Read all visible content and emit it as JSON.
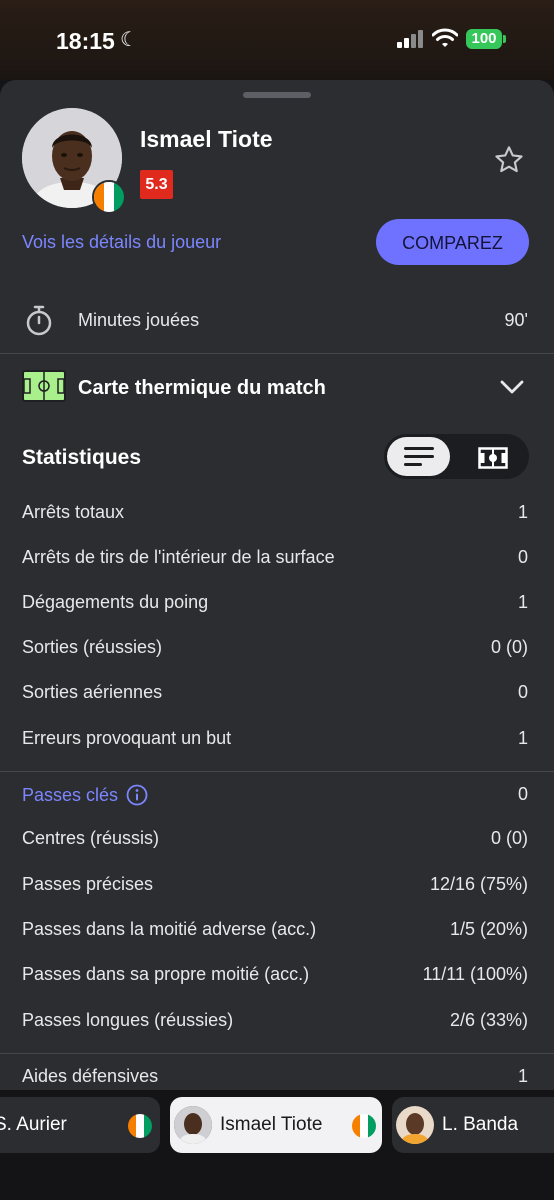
{
  "status_bar": {
    "time": "18:15",
    "battery": "100"
  },
  "player": {
    "name": "Ismael Tiote",
    "rating": "5.3",
    "details_link": "Vois les détails du joueur",
    "compare_label": "COMPAREZ"
  },
  "minutes": {
    "label": "Minutes jouées",
    "value": "90'"
  },
  "heatmap": {
    "label": "Carte thermique du match"
  },
  "stats": {
    "title": "Statistiques",
    "group1": [
      {
        "label": "Arrêts totaux",
        "value": "1"
      },
      {
        "label": "Arrêts de tirs de l'intérieur de la surface",
        "value": "0"
      },
      {
        "label": "Dégagements du poing",
        "value": "1"
      },
      {
        "label": "Sorties (réussies)",
        "value": "0 (0)"
      },
      {
        "label": "Sorties aériennes",
        "value": "0"
      },
      {
        "label": "Erreurs provoquant un but",
        "value": "1"
      }
    ],
    "group2": [
      {
        "label": "Passes clés",
        "value": "0"
      },
      {
        "label": "Centres (réussis)",
        "value": "0 (0)"
      },
      {
        "label": "Passes précises",
        "value": "12/16 (75%)"
      },
      {
        "label": "Passes dans la moitié adverse (acc.)",
        "value": "1/5 (20%)"
      },
      {
        "label": "Passes dans sa propre moitié (acc.)",
        "value": "11/11 (100%)"
      },
      {
        "label": "Passes longues (réussies)",
        "value": "2/6 (33%)"
      }
    ],
    "group3": [
      {
        "label": "Aides défensives",
        "value": "1"
      }
    ]
  },
  "players_bar": [
    {
      "name": "S. Aurier"
    },
    {
      "name": "Ismael Tiote"
    },
    {
      "name": "L. Banda"
    }
  ],
  "colors": {
    "accent": "#6f72ff",
    "link": "#7b86ff",
    "rating_bg": "#e02a1d",
    "sheet_bg": "#2c2d31",
    "heatmap_icon": "#a9f08d"
  },
  "icons": [
    "moon-icon",
    "signal-icon",
    "wifi-icon",
    "star-icon",
    "stopwatch-icon",
    "pitch-icon",
    "chevron-down-icon",
    "list-view-icon",
    "pitch-view-icon",
    "info-icon",
    "ivory-coast-flag-icon"
  ]
}
